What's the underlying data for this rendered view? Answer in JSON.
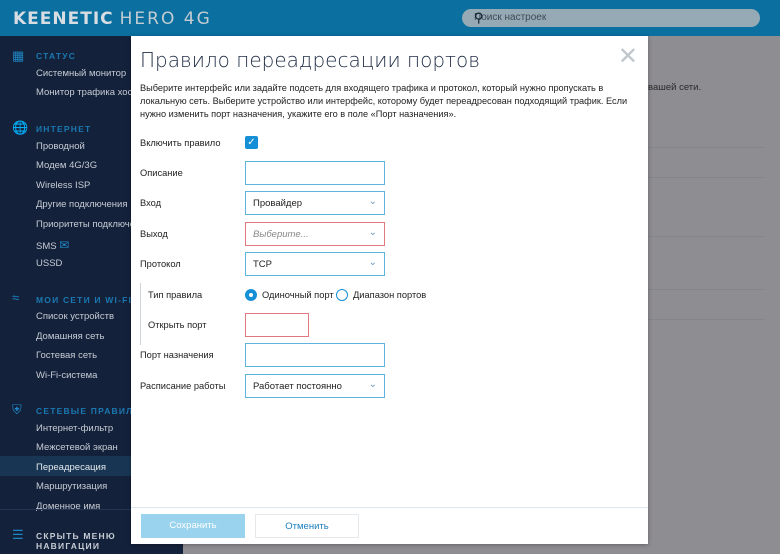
{
  "header": {
    "brand": "KEENETIC",
    "model": "HERO 4G",
    "search_placeholder": "Поиск настроек"
  },
  "sidebar": {
    "sections": [
      {
        "title": "СТАТУС",
        "icon": "dashboard-icon",
        "items": [
          "Системный монитор",
          "Монитор трафика хостов"
        ]
      },
      {
        "title": "ИНТЕРНЕТ",
        "icon": "globe-icon",
        "items": [
          "Проводной",
          "Модем 4G/3G",
          "Wireless ISP",
          "Другие подключения",
          "Приоритеты подключений",
          "SMS",
          "USSD"
        ]
      },
      {
        "title": "МОИ СЕТИ И WI-FI",
        "icon": "wifi-icon",
        "items": [
          "Список устройств",
          "Домашняя сеть",
          "Гостевая сеть",
          "Wi-Fi-система"
        ]
      },
      {
        "title": "СЕТЕВЫЕ ПРАВИЛА",
        "icon": "shield-icon",
        "items": [
          "Интернет-фильтр",
          "Межсетевой экран",
          "Переадресация",
          "Маршрутизация",
          "Доменное имя"
        ]
      }
    ],
    "active": "Переадресация",
    "hide_menu": "СКРЫТЬ МЕНЮ НАВИГАЦИИ"
  },
  "background": {
    "text": "вашей сети."
  },
  "modal": {
    "title": "Правило переадресации портов",
    "description": "Выберите интерфейс или задайте подсеть для входящего трафика и протокол, который нужно пропускать в локальную сеть. Выберите устройство или интерфейс, которому будет переадресован подходящий трафик. Если нужно изменить порт назначения, укажите его в поле «Порт назначения».",
    "enable_label": "Включить правило",
    "enable_checked": true,
    "description_label": "Описание",
    "description_value": "",
    "input_label": "Вход",
    "input_value": "Провайдер",
    "output_label": "Выход",
    "output_placeholder": "Выберите...",
    "protocol_label": "Протокол",
    "protocol_value": "TCP",
    "rule_type_label": "Тип правила",
    "rule_type_options": [
      "Одиночный порт",
      "Диапазон портов"
    ],
    "rule_type_selected": "Одиночный порт",
    "open_port_label": "Открыть порт",
    "open_port_value": "",
    "dest_port_label": "Порт назначения",
    "dest_port_value": "",
    "schedule_label": "Расписание работы",
    "schedule_value": "Работает постоянно",
    "save": "Сохранить",
    "cancel": "Отменить"
  }
}
